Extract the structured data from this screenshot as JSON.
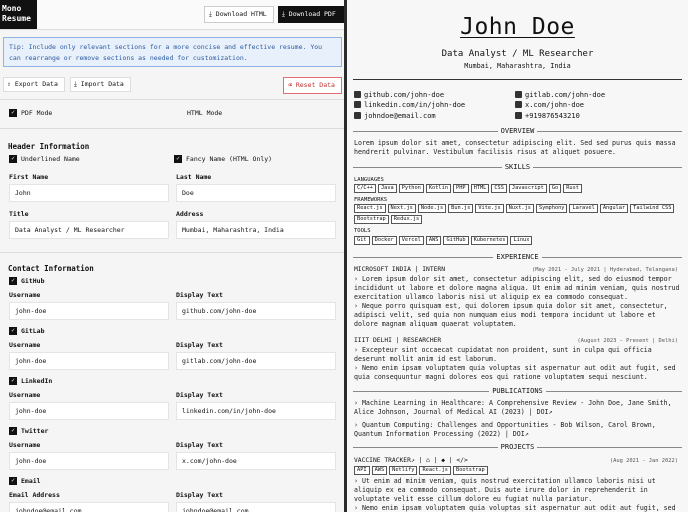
{
  "app": {
    "logo_line1": "Mono",
    "logo_line2": "Resume"
  },
  "toolbar": {
    "download_html": "Download HTML",
    "download_pdf": "Download PDF"
  },
  "tip": "Tip: Include only relevant sections for a more concise and effective resume. You can rearrange or remove sections as needed for customization.",
  "actions": {
    "export": "Export Data",
    "import": "Import Data",
    "reset": "Reset Data"
  },
  "modes": {
    "pdf": "PDF Mode",
    "html": "HTML Mode"
  },
  "header_info": {
    "title": "Header Information",
    "underlined_name": "Underlined Name",
    "fancy_name": "Fancy Name (HTML Only)",
    "first_name_label": "First Name",
    "first_name": "John",
    "last_name_label": "Last Name",
    "last_name": "Doe",
    "title_label": "Title",
    "title_value": "Data Analyst / ML Researcher",
    "address_label": "Address",
    "address": "Mumbai, Maharashtra, India"
  },
  "contact": {
    "title": "Contact Information",
    "username_label": "Username",
    "display_label": "Display Text",
    "email_label": "Email Address",
    "items": [
      {
        "name": "GitHub",
        "username": "john-doe",
        "display": "github.com/john-doe"
      },
      {
        "name": "GitLab",
        "username": "john-doe",
        "display": "gitlab.com/john-doe"
      },
      {
        "name": "LinkedIn",
        "username": "john-doe",
        "display": "linkedin.com/in/john-doe"
      },
      {
        "name": "Twitter",
        "username": "john-doe",
        "display": "x.com/john-doe"
      },
      {
        "name": "Email",
        "username": "johndoe@email.com",
        "display": "johndoe@email.com"
      }
    ]
  },
  "resume": {
    "name": "John Doe",
    "title": "Data Analyst / ML Researcher",
    "location": "Mumbai, Maharashtra, India",
    "contacts": [
      {
        "icon": "github-icon",
        "text": "github.com/john-doe"
      },
      {
        "icon": "gitlab-icon",
        "text": "gitlab.com/john-doe"
      },
      {
        "icon": "linkedin-icon",
        "text": "linkedin.com/in/john-doe"
      },
      {
        "icon": "x-icon",
        "text": "x.com/john-doe"
      },
      {
        "icon": "email-icon",
        "text": "johndoe@email.com"
      },
      {
        "icon": "phone-icon",
        "text": "+919876543210"
      }
    ],
    "overview_title": "OVERVIEW",
    "overview": "Lorem ipsum dolor sit amet, consectetur adipiscing elit. Sed sed purus quis massa hendrerit pulvinar. Vestibulum facilisis risus at aliquet posuere.",
    "skills_title": "SKILLS",
    "skills": [
      {
        "category": "LANGUAGES",
        "items": [
          "C/C++",
          "Java",
          "Python",
          "Kotlin",
          "PHP",
          "HTML",
          "CSS",
          "Javascript",
          "Go",
          "Rust"
        ]
      },
      {
        "category": "FRAMEWORKS",
        "items": [
          "React.js",
          "Next.js",
          "Node.js",
          "Bun.js",
          "Vite.js",
          "Nuxt.js",
          "Symphony",
          "Laravel",
          "Angular",
          "Tailwind CSS",
          "Bootstrap",
          "Redux.js"
        ]
      },
      {
        "category": "TOOLS",
        "items": [
          "Git",
          "Docker",
          "Vercel",
          "AWS",
          "GitHub",
          "Kubernetes",
          "Linux"
        ]
      }
    ],
    "experience_title": "EXPERIENCE",
    "experience": [
      {
        "heading": "MICROSOFT INDIA | INTERN",
        "meta": "(May 2021 - July 2021 | Hyderabad, Telangana)",
        "bullets": [
          "› Lorem ipsum dolor sit amet, consectetur adipiscing elit, sed do eiusmod tempor incididunt ut labore et dolore magna aliqua. Ut enim ad minim veniam, quis nostrud exercitation ullamco laboris nisi ut aliquip ex ea commodo consequat.",
          "› Neque porro quisquam est, qui dolorem ipsum quia dolor sit amet, consectetur, adipisci velit, sed quia non numquam eius modi tempora incidunt ut labore et dolore magnam aliquam quaerat voluptatem."
        ]
      },
      {
        "heading": "IIIT DELHI | RESEARCHER",
        "meta": "(August 2023 - Present | Delhi)",
        "bullets": [
          "› Excepteur sint occaecat cupidatat non proident, sunt in culpa qui officia deserunt mollit anim id est laborum.",
          "› Nemo enim ipsam voluptatem quia voluptas sit aspernatur aut odit aut fugit, sed quia consequuntur magni dolores eos qui ratione voluptatem sequi nesciunt."
        ]
      }
    ],
    "publications_title": "PUBLICATIONS",
    "publications": [
      "› Machine Learning in Healthcare: A Comprehensive Review - John Doe, Jane Smith, Alice Johnson, Journal of Medical AI (2023) | DOI↗",
      "› Quantum Computing: Challenges and Opportunities - Bob Wilson, Carol Brown, Quantum Information Processing (2022) | DOI↗"
    ],
    "projects_title": "PROJECTS",
    "project": {
      "name": "VACCINE TRACKER↗ | ⌂ | ◆ | </>",
      "meta": "(Aug 2021 - Jan 2022)",
      "tags": [
        "API",
        "AWS",
        "Netlify",
        "React.js",
        "Bootstrap"
      ],
      "bullets": [
        "› Ut enim ad minim veniam, quis nostrud exercitation ullamco laboris nisi ut aliquip ex ea commodo consequat. Duis aute irure dolor in reprehenderit in voluptate velit esse cillum dolore eu fugiat nulla pariatur.",
        "› Nemo enim ipsam voluptatem quia voluptas sit aspernatur aut odit aut fugit, sed"
      ]
    }
  }
}
